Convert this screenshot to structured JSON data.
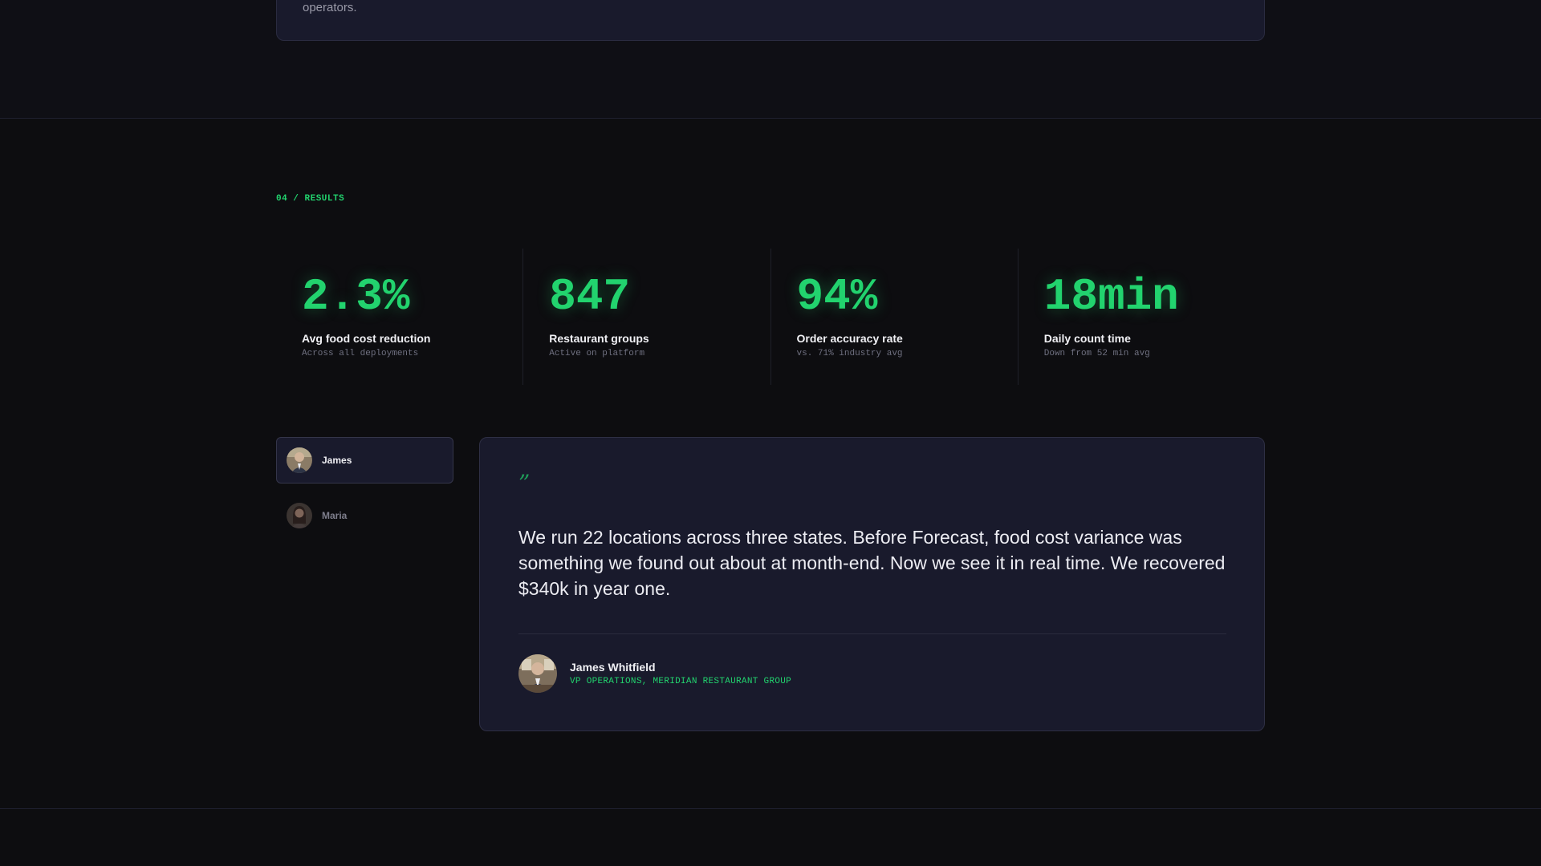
{
  "top_card": {
    "text": "operators."
  },
  "results": {
    "section_label": "04 / RESULTS",
    "stats": [
      {
        "value": "2.3%",
        "label": "Avg food cost reduction",
        "sub": "Across all deployments"
      },
      {
        "value": "847",
        "label": "Restaurant groups",
        "sub": "Active on platform"
      },
      {
        "value": "94%",
        "label": "Order accuracy rate",
        "sub": "vs. 71% industry avg"
      },
      {
        "value": "18min",
        "label": "Daily count time",
        "sub": "Down from 52 min avg"
      }
    ]
  },
  "testimonials": {
    "people": [
      {
        "name": "James",
        "active": true
      },
      {
        "name": "Maria",
        "active": false
      }
    ],
    "active": {
      "quote_mark": "”",
      "quote": "We run 22 locations across three states. Before Forecast, food cost variance was something we found out about at month-end. Now we see it in real time. We recovered $340k in year one.",
      "author_name": "James Whitfield",
      "author_role": "VP OPERATIONS, MERIDIAN RESTAURANT GROUP"
    }
  },
  "colors": {
    "accent": "#22d36e",
    "background": "#0d0d10",
    "card": "#191a2c"
  }
}
